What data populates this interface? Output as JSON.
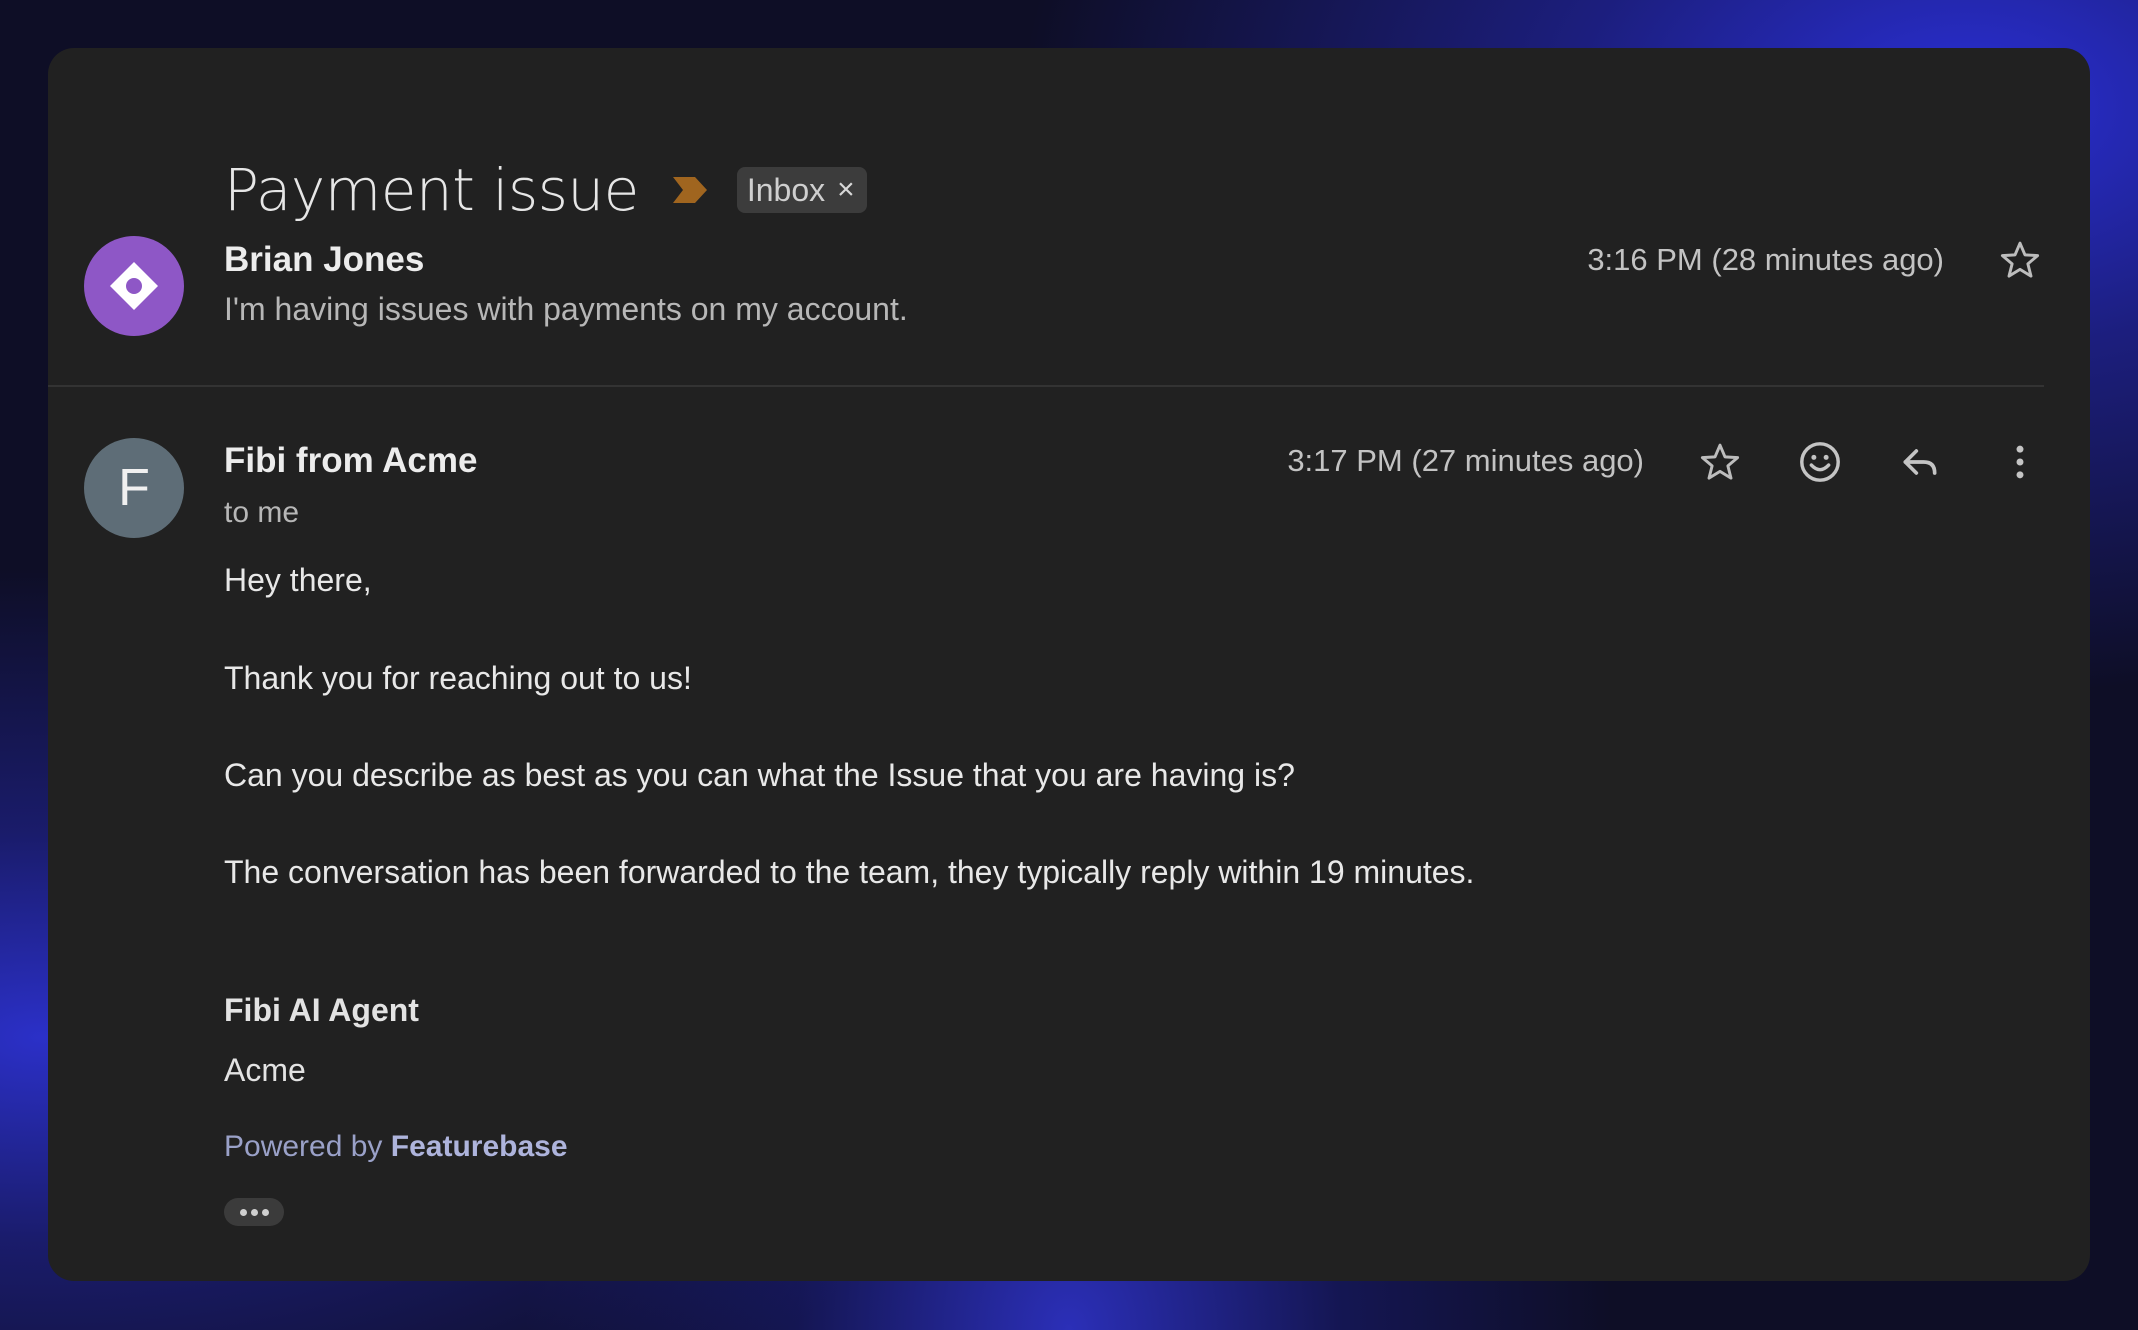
{
  "thread": {
    "subject": "Payment issue",
    "label": "Inbox",
    "label_remove": "×"
  },
  "messages": [
    {
      "sender": "Brian Jones",
      "snippet": "I'm having issues with payments on my account.",
      "time": "3:16 PM (28 minutes ago)",
      "avatar_color": "#8e57c6"
    },
    {
      "sender": "Fibi from Acme",
      "avatar_letter": "F",
      "to": "to me",
      "time": "3:17 PM (27 minutes ago)",
      "avatar_color": "#5e6d77",
      "body": [
        "Hey there,",
        "Thank you for reaching out to us!",
        "Can you describe as best as you can what the Issue that you are having is?",
        "The conversation has been forwarded to the team, they typically reply within 19 minutes."
      ],
      "signature": {
        "name": "Fibi AI Agent",
        "company": "Acme"
      },
      "powered_by_prefix": "Powered by",
      "powered_by_brand": "Featurebase"
    }
  ],
  "icons": [
    "importance-marker-icon",
    "star-icon",
    "emoji-icon",
    "reply-icon",
    "more-vert-icon"
  ],
  "colors": {
    "background": "#212121",
    "importance": "#a0651f",
    "powered_by": "#9aa1c8"
  }
}
